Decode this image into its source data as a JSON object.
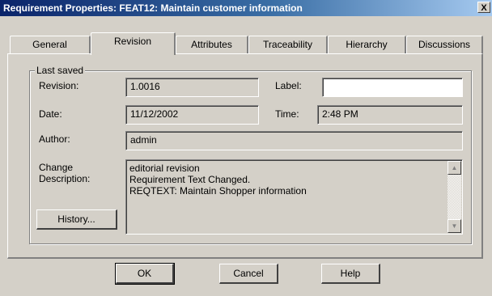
{
  "window": {
    "title": "Requirement Properties: FEAT12: Maintain customer information",
    "close_label": "X"
  },
  "tabs": [
    {
      "label": "General",
      "active": false
    },
    {
      "label": "Revision",
      "active": true
    },
    {
      "label": "Attributes",
      "active": false
    },
    {
      "label": "Traceability",
      "active": false
    },
    {
      "label": "Hierarchy",
      "active": false
    },
    {
      "label": "Discussions",
      "active": false
    }
  ],
  "revision_panel": {
    "group_label": "Last saved",
    "revision_label": "Revision:",
    "revision_value": "1.0016",
    "label_label": "Label:",
    "label_value": "",
    "date_label": "Date:",
    "date_value": "11/12/2002",
    "time_label": "Time:",
    "time_value": "2:48 PM",
    "author_label": "Author:",
    "author_value": "admin",
    "change_label_line1": "Change",
    "change_label_line2": "Description:",
    "change_lines": [
      "editorial revision",
      "Requirement Text Changed.",
      "REQTEXT: Maintain Shopper information"
    ],
    "history_button": "History..."
  },
  "footer": {
    "ok": "OK",
    "cancel": "Cancel",
    "help": "Help"
  },
  "icons": {
    "scroll_up": "up-arrow",
    "scroll_down": "down-arrow"
  },
  "colors": {
    "dialog_bg": "#d4d0c8",
    "titlebar_start": "#0a246a",
    "titlebar_end": "#a6caf0"
  }
}
